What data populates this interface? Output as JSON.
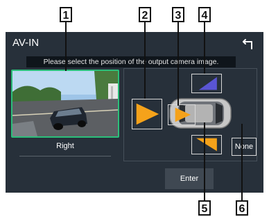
{
  "callouts": [
    "1",
    "2",
    "3",
    "4",
    "5",
    "6"
  ],
  "screen": {
    "title": "AV-IN",
    "back_icon": "back-arrow-icon",
    "prompt": "Please select the position of the output camera image.",
    "preview_label": "Right",
    "none_label": "None",
    "enter_label": "Enter"
  },
  "colors": {
    "background": "#27303a",
    "selection_border": "#2bbf7a",
    "arrow_orange": "#f5a21a",
    "arrow_blue": "#5a55d4"
  }
}
